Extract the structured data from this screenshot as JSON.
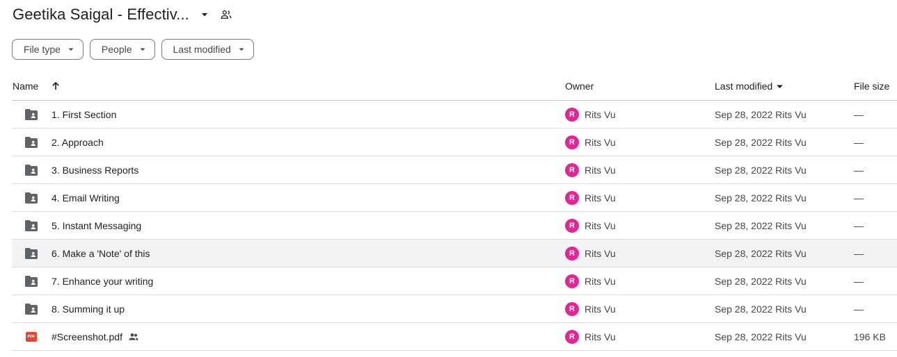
{
  "header": {
    "title": "Geetika Saigal - Effectiv..."
  },
  "filters": [
    {
      "label": "File type"
    },
    {
      "label": "People"
    },
    {
      "label": "Last modified"
    }
  ],
  "columns": {
    "name": "Name",
    "owner": "Owner",
    "last_modified": "Last modified",
    "file_size": "File size"
  },
  "rows": [
    {
      "name": "1. First Section",
      "type": "shared-folder",
      "owner_initial": "R",
      "owner": "Rits Vu",
      "modified": "Sep 28, 2022 Rits Vu",
      "size": "—"
    },
    {
      "name": "2. Approach",
      "type": "shared-folder",
      "owner_initial": "R",
      "owner": "Rits Vu",
      "modified": "Sep 28, 2022 Rits Vu",
      "size": "—"
    },
    {
      "name": "3. Business Reports",
      "type": "shared-folder",
      "owner_initial": "R",
      "owner": "Rits Vu",
      "modified": "Sep 28, 2022 Rits Vu",
      "size": "—"
    },
    {
      "name": "4. Email Writing",
      "type": "shared-folder",
      "owner_initial": "R",
      "owner": "Rits Vu",
      "modified": "Sep 28, 2022 Rits Vu",
      "size": "—"
    },
    {
      "name": "5. Instant Messaging",
      "type": "shared-folder",
      "owner_initial": "R",
      "owner": "Rits Vu",
      "modified": "Sep 28, 2022 Rits Vu",
      "size": "—"
    },
    {
      "name": "6. Make a 'Note' of this",
      "type": "shared-folder",
      "owner_initial": "R",
      "owner": "Rits Vu",
      "modified": "Sep 28, 2022 Rits Vu",
      "size": "—"
    },
    {
      "name": "7. Enhance your writing",
      "type": "shared-folder",
      "owner_initial": "R",
      "owner": "Rits Vu",
      "modified": "Sep 28, 2022 Rits Vu",
      "size": "—"
    },
    {
      "name": "8. Summing it up",
      "type": "shared-folder",
      "owner_initial": "R",
      "owner": "Rits Vu",
      "modified": "Sep 28, 2022 Rits Vu",
      "size": "—"
    },
    {
      "name": "#Screenshot.pdf",
      "type": "pdf",
      "pdf_badge": "PDF",
      "owner_initial": "R",
      "owner": "Rits Vu",
      "modified": "Sep 28, 2022 Rits Vu",
      "size": "196 KB"
    }
  ],
  "colors": {
    "avatar": "#e52592",
    "pdf": "#ea4335",
    "folder": "#5f6368",
    "hover_row": "#f1f3f4"
  }
}
